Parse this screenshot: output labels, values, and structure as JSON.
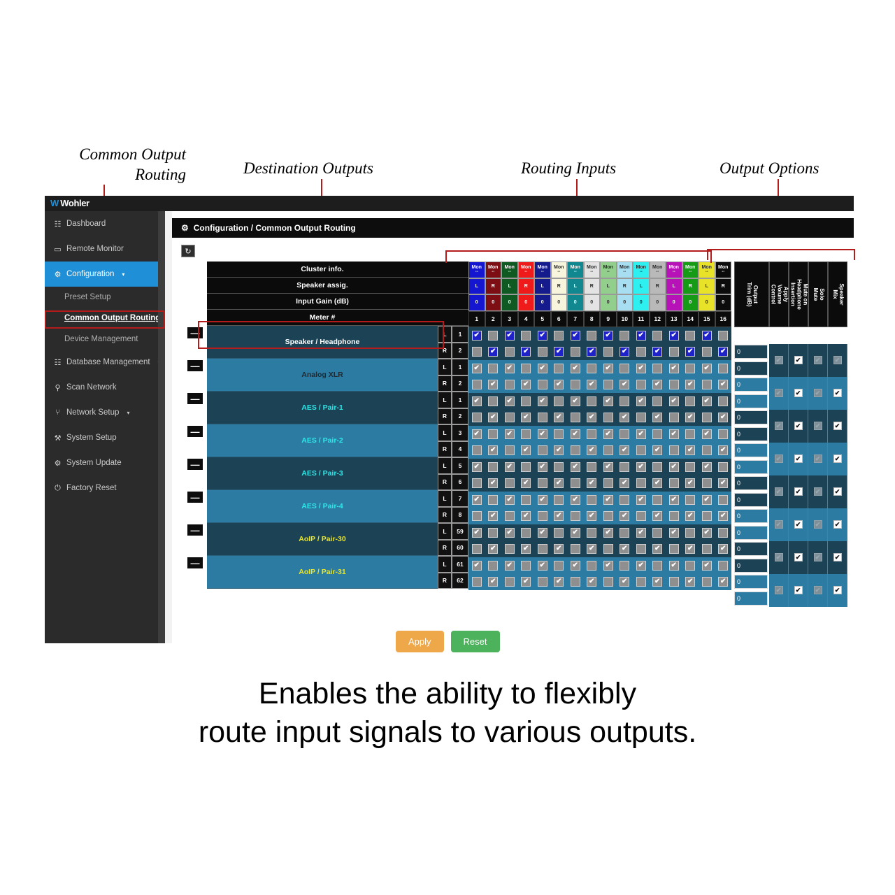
{
  "annotations": [
    {
      "id": "common-output-routing",
      "text": "Common Output\nRouting"
    },
    {
      "id": "destination-outputs",
      "text": "Destination Outputs"
    },
    {
      "id": "routing-inputs",
      "text": "Routing Inputs"
    },
    {
      "id": "output-options",
      "text": "Output Options"
    }
  ],
  "caption": "Enables the ability to flexibly\nroute input signals to various outputs.",
  "brand": {
    "logo_mark": "W",
    "logo_text": "Wohler"
  },
  "sidebar": {
    "items": [
      {
        "label": "Dashboard",
        "icon": "dashboard-icon",
        "glyph": "☷",
        "type": "item",
        "active": false
      },
      {
        "label": "Remote Monitor",
        "icon": "monitor-icon",
        "glyph": "▭",
        "type": "item",
        "active": false
      },
      {
        "label": "Configuration",
        "icon": "gears-icon",
        "glyph": "⚙",
        "type": "item",
        "active": true,
        "caret": "▾"
      },
      {
        "label": "Preset Setup",
        "icon": "",
        "glyph": "",
        "type": "sub",
        "current": false
      },
      {
        "label": "Common Output Routing",
        "icon": "",
        "glyph": "",
        "type": "sub",
        "current": true
      },
      {
        "label": "Device Management",
        "icon": "",
        "glyph": "",
        "type": "sub",
        "current": false
      },
      {
        "label": "Database Management",
        "icon": "database-icon",
        "glyph": "☷",
        "type": "item",
        "active": false,
        "caret": "▾"
      },
      {
        "label": "Scan Network",
        "icon": "search-icon",
        "glyph": "⚲",
        "type": "item",
        "active": false
      },
      {
        "label": "Network Setup",
        "icon": "sitemap-icon",
        "glyph": "⑂",
        "type": "item",
        "active": false,
        "caret": "▾"
      },
      {
        "label": "System Setup",
        "icon": "wrench-icon",
        "glyph": "⚒",
        "type": "item",
        "active": false
      },
      {
        "label": "System Update",
        "icon": "gear-icon",
        "glyph": "⚙",
        "type": "item",
        "active": false
      },
      {
        "label": "Factory Reset",
        "icon": "power-icon",
        "glyph": "⏻",
        "type": "item",
        "active": false
      }
    ]
  },
  "panel": {
    "icon": "gears-icon",
    "title": "Configuration / Common Output Routing",
    "refresh_icon": "refresh-icon",
    "refresh_glyph": "↻"
  },
  "matrix": {
    "header_row_labels": [
      "Cluster info.",
      "Speaker assig.",
      "Input Gain (dB)",
      "Meter #"
    ],
    "collapse_glyph": "—",
    "inputs": [
      {
        "meter": "1",
        "cluster": "Mon",
        "dash": "--",
        "speaker": "L",
        "gain": "0",
        "bg": "#1516cf",
        "fg": "#ffffff"
      },
      {
        "meter": "2",
        "cluster": "Mon",
        "dash": "--",
        "speaker": "R",
        "gain": "0",
        "bg": "#7d0f14",
        "fg": "#ffffff"
      },
      {
        "meter": "3",
        "cluster": "Mon",
        "dash": "--",
        "speaker": "L",
        "gain": "0",
        "bg": "#0e5a22",
        "fg": "#ffffff"
      },
      {
        "meter": "4",
        "cluster": "Mon",
        "dash": "--",
        "speaker": "R",
        "gain": "0",
        "bg": "#ef1b1b",
        "fg": "#ffffff"
      },
      {
        "meter": "5",
        "cluster": "Mon",
        "dash": "--",
        "speaker": "L",
        "gain": "0",
        "bg": "#151a8c",
        "fg": "#ffffff"
      },
      {
        "meter": "6",
        "cluster": "Mon",
        "dash": "--",
        "speaker": "R",
        "gain": "0",
        "bg": "#f7f5dc",
        "fg": "#2a2a2a"
      },
      {
        "meter": "7",
        "cluster": "Mon",
        "dash": "--",
        "speaker": "L",
        "gain": "0",
        "bg": "#11878f",
        "fg": "#ffffff"
      },
      {
        "meter": "8",
        "cluster": "Mon",
        "dash": "--",
        "speaker": "R",
        "gain": "0",
        "bg": "#e3e3e3",
        "fg": "#2a2a2a"
      },
      {
        "meter": "9",
        "cluster": "Mon",
        "dash": "--",
        "speaker": "L",
        "gain": "0",
        "bg": "#92cf8c",
        "fg": "#2a2a2a"
      },
      {
        "meter": "10",
        "cluster": "Mon",
        "dash": "--",
        "speaker": "R",
        "gain": "0",
        "bg": "#a8def2",
        "fg": "#2a2a2a"
      },
      {
        "meter": "11",
        "cluster": "Mon",
        "dash": "--",
        "speaker": "L",
        "gain": "0",
        "bg": "#2ef0f0",
        "fg": "#2a2a2a"
      },
      {
        "meter": "12",
        "cluster": "Mon",
        "dash": "--",
        "speaker": "R",
        "gain": "0",
        "bg": "#b9b9b9",
        "fg": "#2a2a2a"
      },
      {
        "meter": "13",
        "cluster": "Mon",
        "dash": "--",
        "speaker": "L",
        "gain": "0",
        "bg": "#b712b7",
        "fg": "#ffffff"
      },
      {
        "meter": "14",
        "cluster": "Mon",
        "dash": "--",
        "speaker": "R",
        "gain": "0",
        "bg": "#169b16",
        "fg": "#ffffff"
      },
      {
        "meter": "15",
        "cluster": "Mon",
        "dash": "--",
        "speaker": "L",
        "gain": "0",
        "bg": "#e8e328",
        "fg": "#2a2a2a"
      },
      {
        "meter": "16",
        "cluster": "Mon",
        "dash": "--",
        "speaker": "R",
        "gain": "0",
        "bg": "#0b0b0b",
        "fg": "#ffffff"
      }
    ],
    "outputs": [
      {
        "name": "Speaker / Headphone",
        "color": "#ffffff",
        "shade": "dark",
        "channels": [
          {
            "lr": "L",
            "num": "1",
            "parity": "odd"
          },
          {
            "lr": "R",
            "num": "2",
            "parity": "even"
          }
        ],
        "highlight": true,
        "trim": [
          "0",
          "0"
        ],
        "options": [
          "off",
          "on",
          "off",
          "off"
        ]
      },
      {
        "name": "Analog XLR",
        "color": "#1d2a33",
        "shade": "light",
        "channels": [
          {
            "lr": "L",
            "num": "1",
            "parity": "odd"
          },
          {
            "lr": "R",
            "num": "2",
            "parity": "even"
          }
        ],
        "highlight": false,
        "trim": [
          "0",
          "0"
        ],
        "options": [
          "off",
          "on",
          "off",
          "on"
        ]
      },
      {
        "name": "AES / Pair-1",
        "color": "#2ee8e8",
        "shade": "dark",
        "channels": [
          {
            "lr": "L",
            "num": "1",
            "parity": "odd"
          },
          {
            "lr": "R",
            "num": "2",
            "parity": "even"
          }
        ],
        "highlight": false,
        "trim": [
          "0",
          "0"
        ],
        "options": [
          "off",
          "on",
          "off",
          "on"
        ]
      },
      {
        "name": "AES / Pair-2",
        "color": "#2ee8e8",
        "shade": "light",
        "channels": [
          {
            "lr": "L",
            "num": "3",
            "parity": "odd"
          },
          {
            "lr": "R",
            "num": "4",
            "parity": "even"
          }
        ],
        "highlight": false,
        "trim": [
          "0",
          "0"
        ],
        "options": [
          "off",
          "on",
          "off",
          "on"
        ]
      },
      {
        "name": "AES / Pair-3",
        "color": "#2ee8e8",
        "shade": "dark",
        "channels": [
          {
            "lr": "L",
            "num": "5",
            "parity": "odd"
          },
          {
            "lr": "R",
            "num": "6",
            "parity": "even"
          }
        ],
        "highlight": false,
        "trim": [
          "0",
          "0"
        ],
        "options": [
          "off",
          "on",
          "off",
          "on"
        ]
      },
      {
        "name": "AES / Pair-4",
        "color": "#2ee8e8",
        "shade": "light",
        "channels": [
          {
            "lr": "L",
            "num": "7",
            "parity": "odd"
          },
          {
            "lr": "R",
            "num": "8",
            "parity": "even"
          }
        ],
        "highlight": false,
        "trim": [
          "0",
          "0"
        ],
        "options": [
          "off",
          "on",
          "off",
          "on"
        ]
      },
      {
        "name": "AoIP / Pair-30",
        "color": "#e8e328",
        "shade": "dark",
        "channels": [
          {
            "lr": "L",
            "num": "59",
            "parity": "odd"
          },
          {
            "lr": "R",
            "num": "60",
            "parity": "even"
          }
        ],
        "highlight": false,
        "trim": [
          "0",
          "0"
        ],
        "options": [
          "off",
          "on",
          "off",
          "on"
        ]
      },
      {
        "name": "AoIP / Pair-31",
        "color": "#e8e328",
        "shade": "light",
        "channels": [
          {
            "lr": "L",
            "num": "61",
            "parity": "odd"
          },
          {
            "lr": "R",
            "num": "62",
            "parity": "even"
          }
        ],
        "highlight": false,
        "trim": [
          "0",
          "0"
        ],
        "options": [
          "off",
          "on",
          "off",
          "on"
        ]
      }
    ],
    "option_headers": [
      "Output\nTrim (dB)",
      "Apply\nVolume\nControl",
      "Mute on\nHeadphone\nInsertion",
      "Solo\nMute",
      "Speaker\nMix"
    ],
    "check_glyph": "✔"
  },
  "buttons": {
    "apply": "Apply",
    "reset": "Reset",
    "apply_color": "#eea749",
    "reset_color": "#4cb25c"
  },
  "accent": {
    "active_nav": "#1f90d8",
    "annotation_red": "#b41c1c"
  }
}
